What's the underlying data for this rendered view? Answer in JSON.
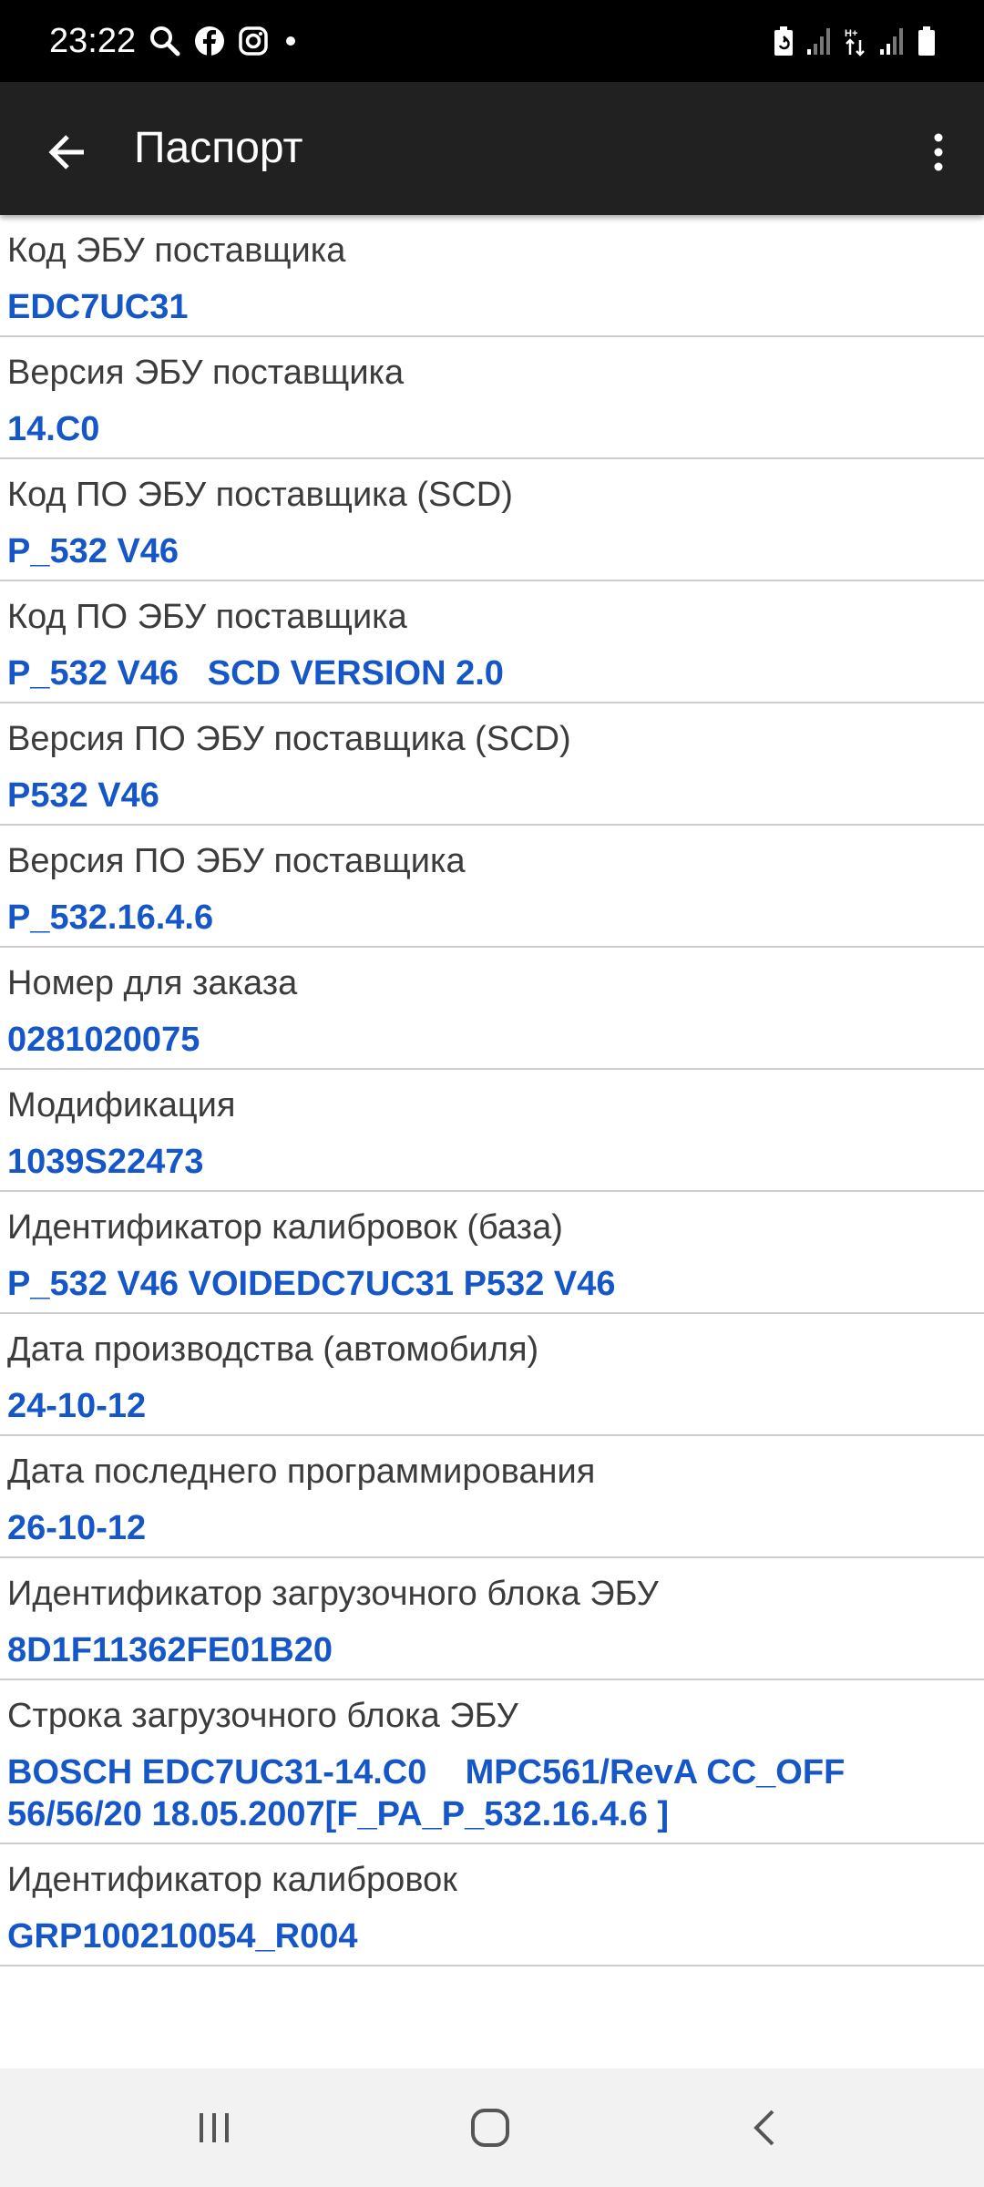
{
  "status_bar": {
    "time": "23:22",
    "left_icons": [
      "search-icon",
      "facebook-icon",
      "instagram-icon",
      "dot-icon"
    ],
    "right_icons": [
      "battery-saver-icon",
      "signal-icon",
      "data-arrows-icon",
      "signal-icon",
      "battery-icon"
    ]
  },
  "app_bar": {
    "title": "Паспорт",
    "back_icon": "arrow-left-icon",
    "menu_icon": "more-vertical-icon"
  },
  "items": [
    {
      "label": "Код ЭБУ поставщика",
      "value": "EDC7UC31"
    },
    {
      "label": "Версия ЭБУ поставщика",
      "value": "14.C0"
    },
    {
      "label": "Код ПО ЭБУ поставщика (SCD)",
      "value": "P_532 V46"
    },
    {
      "label": "Код ПО ЭБУ поставщика",
      "value": "P_532 V46   SCD VERSION 2.0"
    },
    {
      "label": "Версия ПО ЭБУ поставщика (SCD)",
      "value": "P532 V46"
    },
    {
      "label": "Версия ПО ЭБУ поставщика",
      "value": "P_532.16.4.6"
    },
    {
      "label": "Номер для заказа",
      "value": "0281020075"
    },
    {
      "label": "Модификация",
      "value": "1039S22473"
    },
    {
      "label": "Идентификатор калибровок (база)",
      "value": "P_532 V46 VOIDEDC7UC31 P532 V46"
    },
    {
      "label": "Дата производства (автомобиля)",
      "value": "24-10-12"
    },
    {
      "label": "Дата последнего программирования",
      "value": "26-10-12"
    },
    {
      "label": "Идентификатор загрузочного блока ЭБУ",
      "value": "8D1F11362FE01B20"
    },
    {
      "label": "Строка загрузочного блока ЭБУ",
      "value": "BOSCH EDC7UC31-14.C0    MPC561/RevA CC_OFF 56/56/20 18.05.2007[F_PA_P_532.16.4.6 ]"
    },
    {
      "label": "Идентификатор калибровок",
      "value": "GRP100210054_R004"
    }
  ],
  "nav_bar": {
    "icons": [
      "recent-apps-icon",
      "home-icon",
      "back-icon"
    ]
  }
}
